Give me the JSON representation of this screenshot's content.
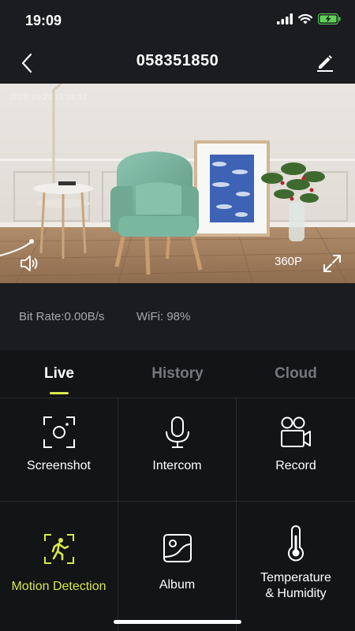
{
  "status_bar": {
    "time": "19:09",
    "icons": [
      "signal-icon",
      "wifi-icon",
      "battery-charging-icon"
    ],
    "battery_color": "#5fd15b"
  },
  "nav": {
    "title": "058351850",
    "back_icon": "chevron-left-icon",
    "edit_icon": "pencil-icon"
  },
  "video": {
    "timestamp": "2020-10-21 19:08:52",
    "resolution": "360P",
    "sound_icon": "speaker-icon",
    "fullscreen_icon": "expand-icon"
  },
  "info": {
    "bit_rate": "Bit Rate:0.00B/s",
    "wifi": "WiFi: 98%"
  },
  "tabs": [
    {
      "label": "Live",
      "active": true
    },
    {
      "label": "History",
      "active": false
    },
    {
      "label": "Cloud",
      "active": false
    }
  ],
  "grid": [
    {
      "label": "Screenshot",
      "icon": "camera-frame-icon"
    },
    {
      "label": "Intercom",
      "icon": "microphone-icon"
    },
    {
      "label": "Record",
      "icon": "video-camera-icon"
    },
    {
      "label": "Motion Detection",
      "icon": "motion-detection-icon"
    },
    {
      "label": "Album",
      "icon": "album-icon"
    },
    {
      "label": "Temperature\n& Humidity",
      "line1": "Temperature",
      "line2": "& Humidity",
      "icon": "thermometer-icon"
    }
  ],
  "colors": {
    "accent": "#d9e84b",
    "background": "#1b1c1f",
    "panel": "#131416",
    "muted_text": "#a8a8ab"
  }
}
